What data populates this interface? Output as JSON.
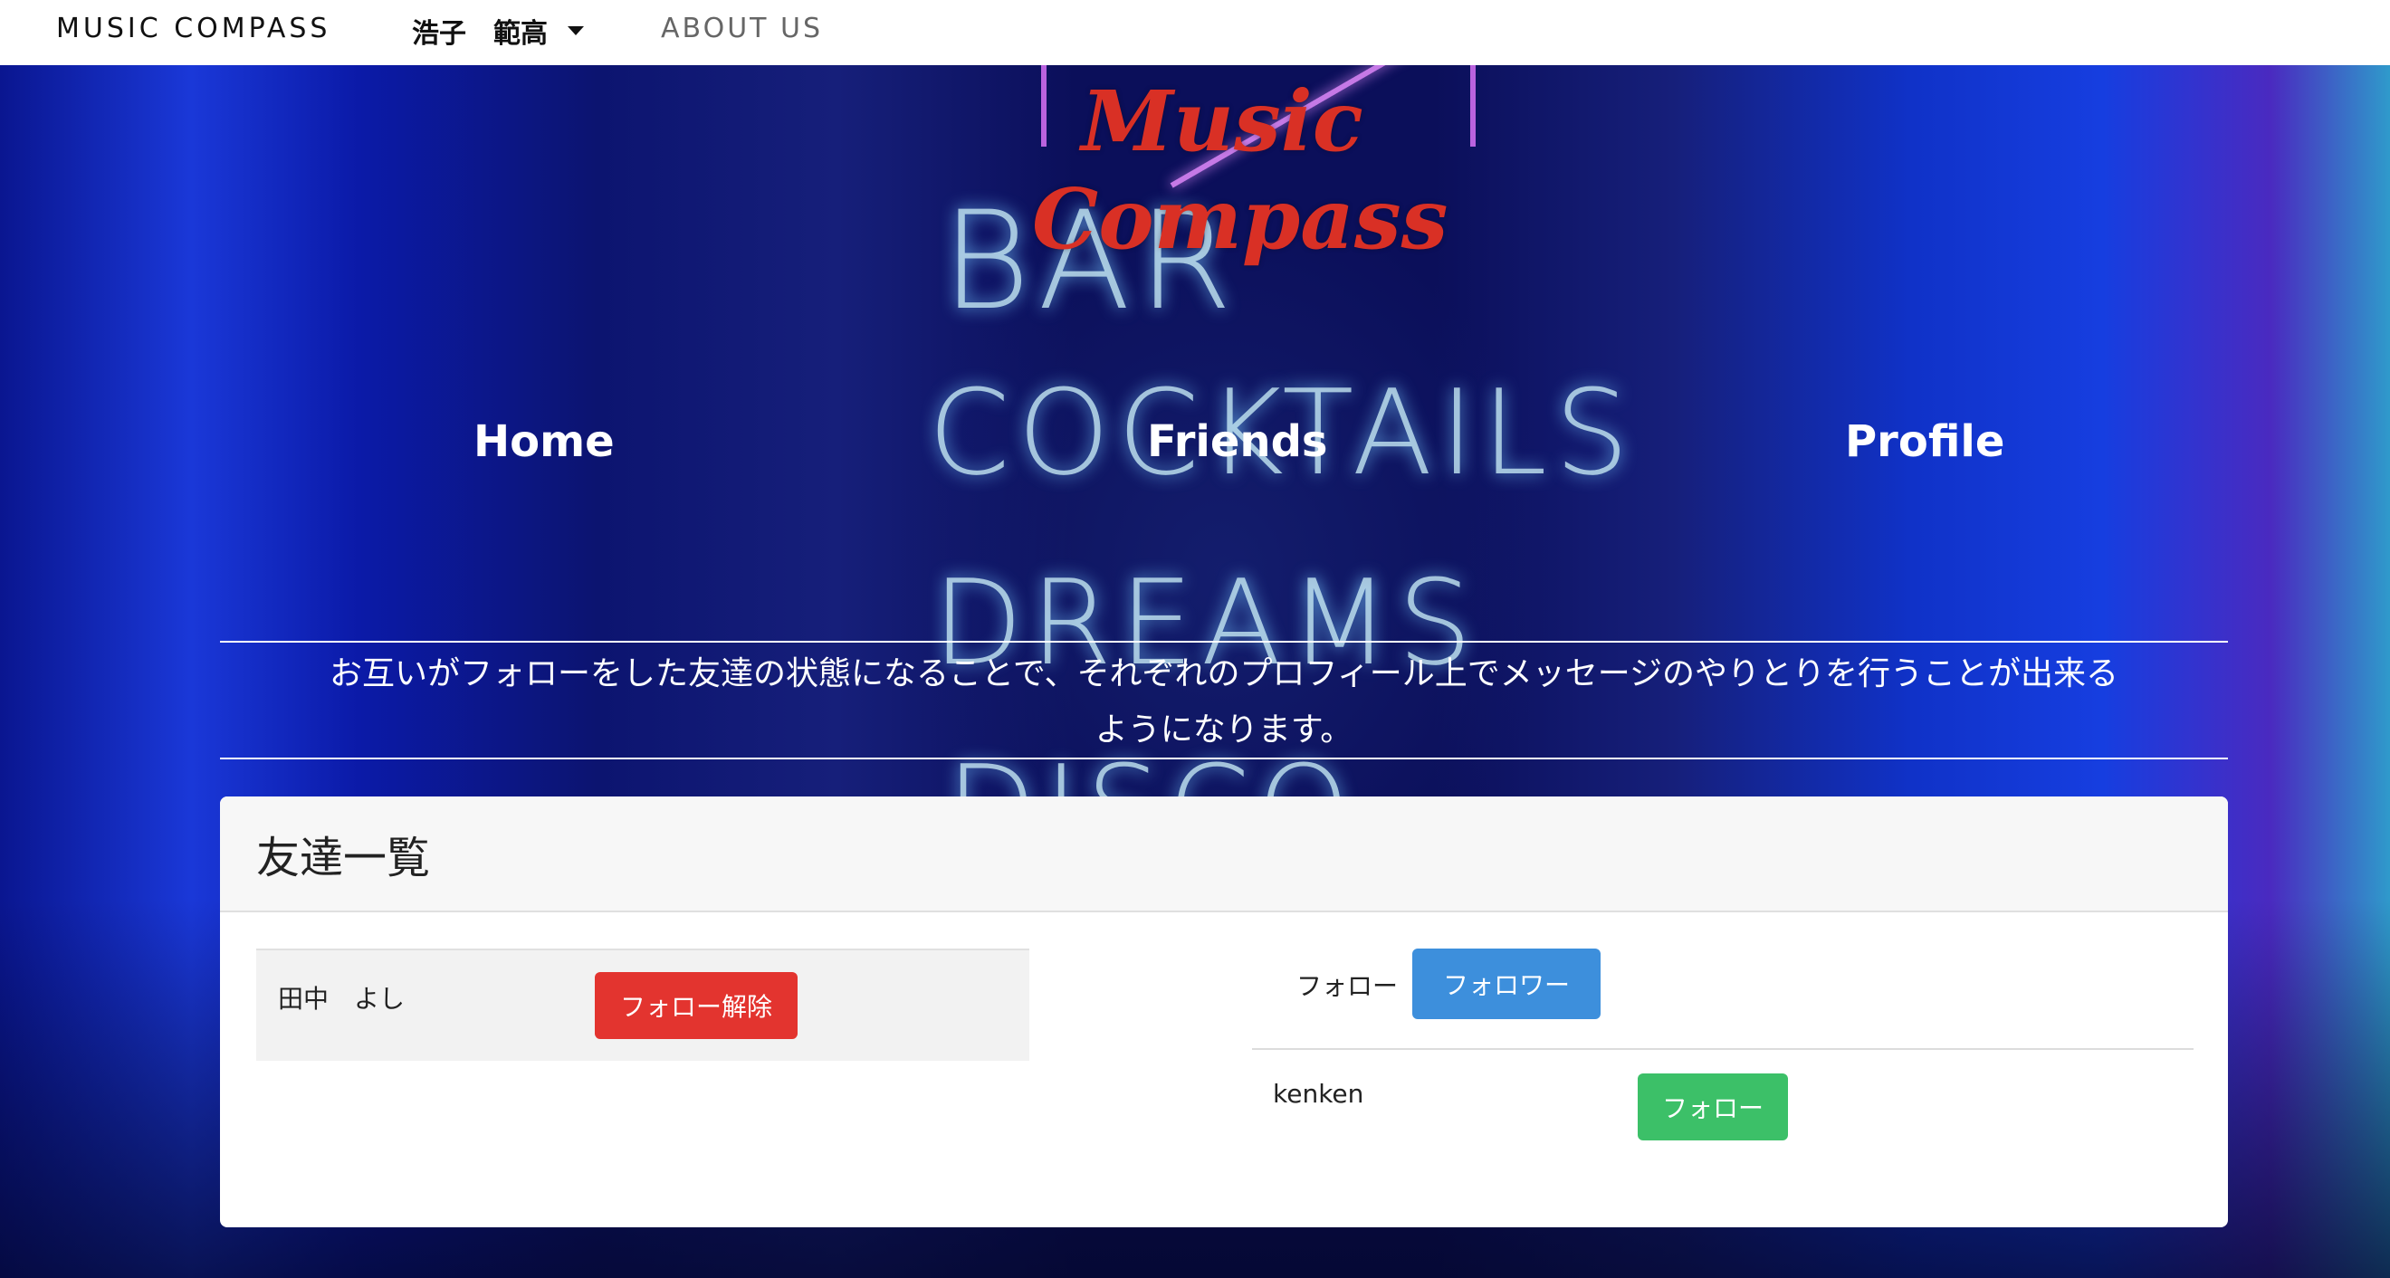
{
  "navbar": {
    "brand": "MUSIC COMPASS",
    "user_name": "浩子　範高",
    "about": "ABOUT US"
  },
  "hero": {
    "logo_line1": "Music",
    "logo_line2": "Compass",
    "neon_words": [
      "BAR",
      "COCKTAILS",
      "DREAMS",
      "DISCO"
    ],
    "nav": {
      "home": "Home",
      "friends": "Friends",
      "profile": "Profile"
    },
    "info_line1": "お互いがフォローをした友達の状態になることで、それぞれのプロフィール上でメッセージのやりとりを行うことが出来る",
    "info_line2": "ようになります。"
  },
  "friends_panel": {
    "title": "友達一覧",
    "friends": [
      {
        "name": "田中　よし",
        "action": "フォロー解除"
      }
    ],
    "tabs": {
      "follow": "フォロー",
      "follower": "フォロワー"
    },
    "followers": [
      {
        "name": "kenken",
        "action": "フォロー"
      }
    ]
  },
  "colors": {
    "logo": "#d93025",
    "unfollow_button": "#e3342f",
    "follower_button": "#3d8fdc",
    "follow_button": "#3cc068"
  }
}
